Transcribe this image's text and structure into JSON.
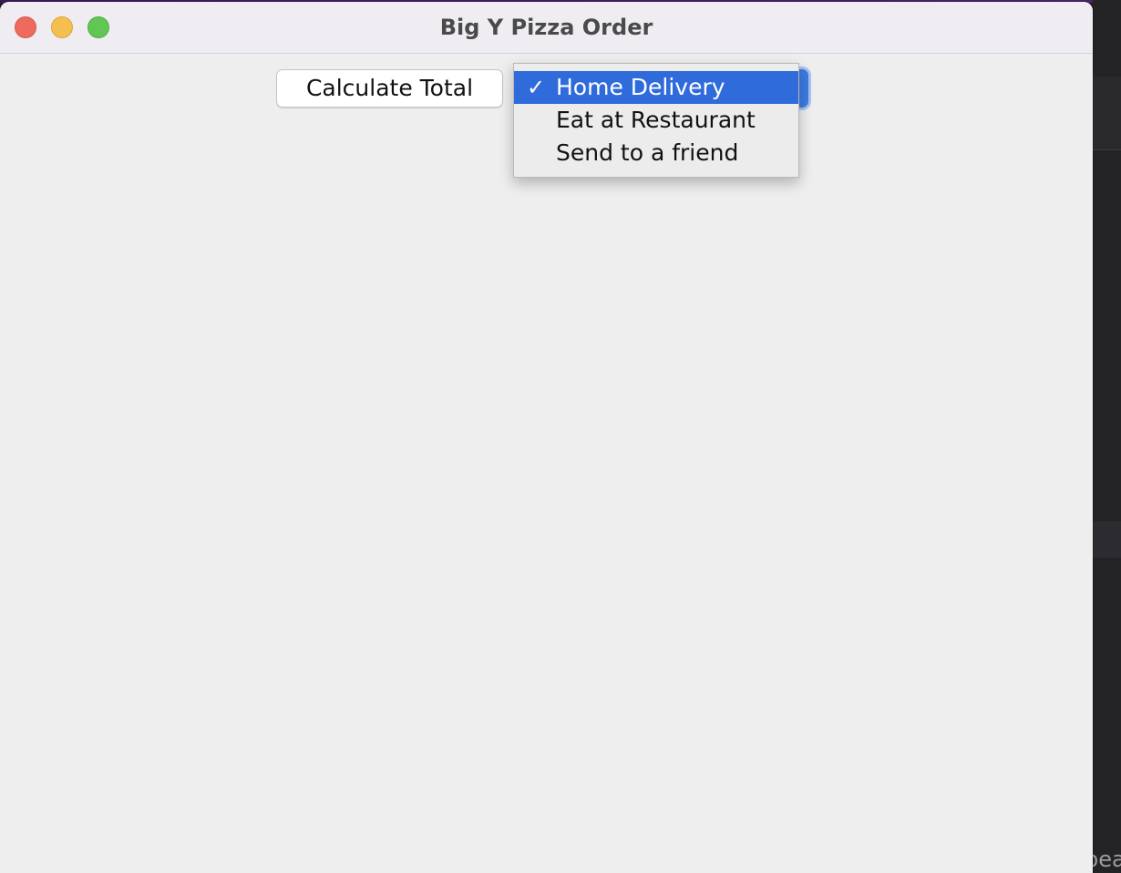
{
  "window": {
    "title": "Big Y Pizza Order"
  },
  "toolbar": {
    "calculate_label": "Calculate Total"
  },
  "delivery_combo": {
    "selected": "Home Delivery",
    "options": [
      {
        "label": "Home Delivery",
        "checked": true
      },
      {
        "label": "Eat at Restaurant",
        "checked": false
      },
      {
        "label": "Send to a friend",
        "checked": false
      }
    ],
    "check_glyph": "✓"
  },
  "background": {
    "partial_text": "bea"
  },
  "colors": {
    "selection": "#2f6bdb",
    "close": "#ee6a5f",
    "minimize": "#f5bf4f",
    "maximize": "#62c655"
  }
}
